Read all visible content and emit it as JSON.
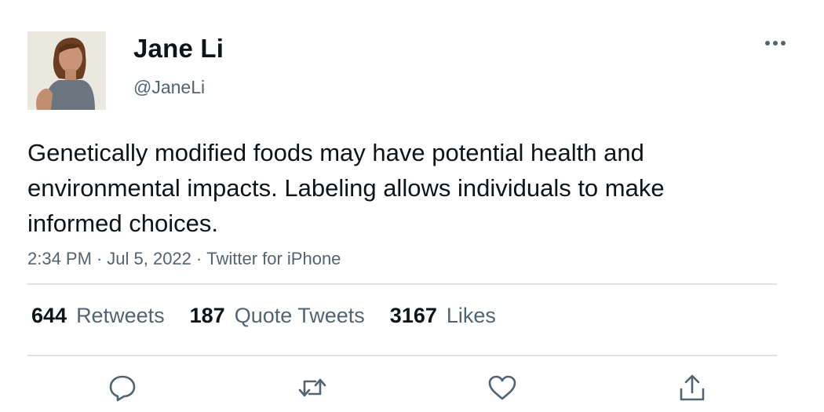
{
  "user": {
    "display_name": "Jane Li",
    "handle": "@JaneLi"
  },
  "tweet": {
    "text": "Genetically modified foods may have potential health and environmental impacts. Labeling allows individuals to make informed choices.",
    "time": "2:34 PM",
    "date": "Jul 5, 2022",
    "source": "Twitter for iPhone",
    "separator": "·"
  },
  "stats": {
    "retweets_count": "644",
    "retweets_label": "Retweets",
    "quotes_count": "187",
    "quotes_label": "Quote Tweets",
    "likes_count": "3167",
    "likes_label": "Likes"
  },
  "icons": {
    "more": "more-icon",
    "reply": "reply-icon",
    "retweet": "retweet-icon",
    "like": "like-icon",
    "share": "share-icon"
  },
  "colors": {
    "text_primary": "#0f1419",
    "text_secondary": "#536471",
    "divider": "#dfe3e6"
  }
}
